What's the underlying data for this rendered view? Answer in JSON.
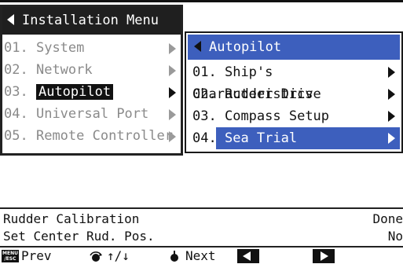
{
  "installation_menu": {
    "title": "Installation Menu",
    "items": [
      {
        "num": "01.",
        "label": "System"
      },
      {
        "num": "02.",
        "label": "Network"
      },
      {
        "num": "03.",
        "label": "Autopilot"
      },
      {
        "num": "04.",
        "label": "Universal Port"
      },
      {
        "num": "05.",
        "label": "Remote Controller"
      }
    ],
    "selected_index": 2
  },
  "autopilot_menu": {
    "title": "Autopilot",
    "items": [
      {
        "num": "01.",
        "label": "Ship's Characteristics"
      },
      {
        "num": "02.",
        "label": "Rudder Drive"
      },
      {
        "num": "03.",
        "label": "Compass Setup"
      },
      {
        "num": "04.",
        "label": "Sea Trial"
      }
    ],
    "selected_index": 3
  },
  "status": {
    "line1_left": "Rudder Calibration",
    "line1_right": "Done",
    "line2_left": "Set Center Rud. Pos.",
    "line2_right": "No"
  },
  "softkeys": {
    "menu_key_top": "MENU",
    "menu_key_bottom": "/ESC",
    "prev_label": "Prev",
    "updown_label": "↑/↓",
    "next_label": "Next"
  },
  "colors": {
    "highlight_blue": "#3d5fbd",
    "title_dark": "#1f1f1f",
    "disabled_gray": "#8a8a8a"
  }
}
